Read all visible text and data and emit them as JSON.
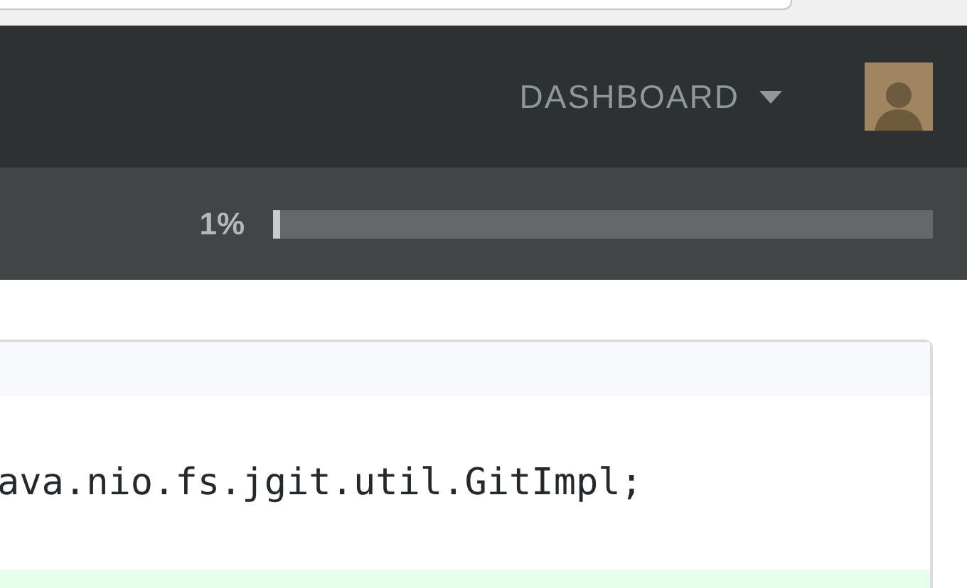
{
  "nav": {
    "menu": "DASHBOARD"
  },
  "progress": {
    "reading": "1%",
    "level": 0.01
  },
  "code": {
    "lines": [
      {
        "kind": "hunk"
      },
      {
        "kind": "context",
        "text": "ava.nio.fs.jgit.util.GitImpl;"
      },
      {
        "kind": "added"
      }
    ]
  }
}
